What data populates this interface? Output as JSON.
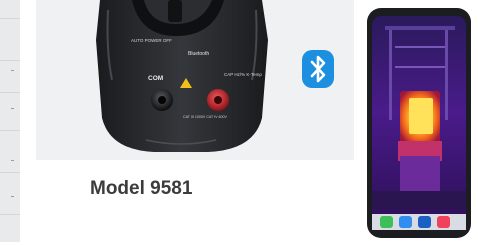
{
  "caption": "Model 9581",
  "meter": {
    "brand_label": "Bluetooth",
    "auto_power_off_label": "AUTO POWER OFF",
    "mode_labels": "CAP Hz/% K-Temp",
    "com_label": "COM",
    "cat_rating": "CAT III 1000V  CAT IV 600V"
  },
  "colors": {
    "bluetooth_blue": "#1d8fe0",
    "meter_body": "#2a2c2f",
    "jack_red": "#c9252b"
  },
  "icons": [
    "bluetooth-icon",
    "phone-icon",
    "call-icon",
    "message-icon",
    "camera-icon",
    "music-icon"
  ]
}
